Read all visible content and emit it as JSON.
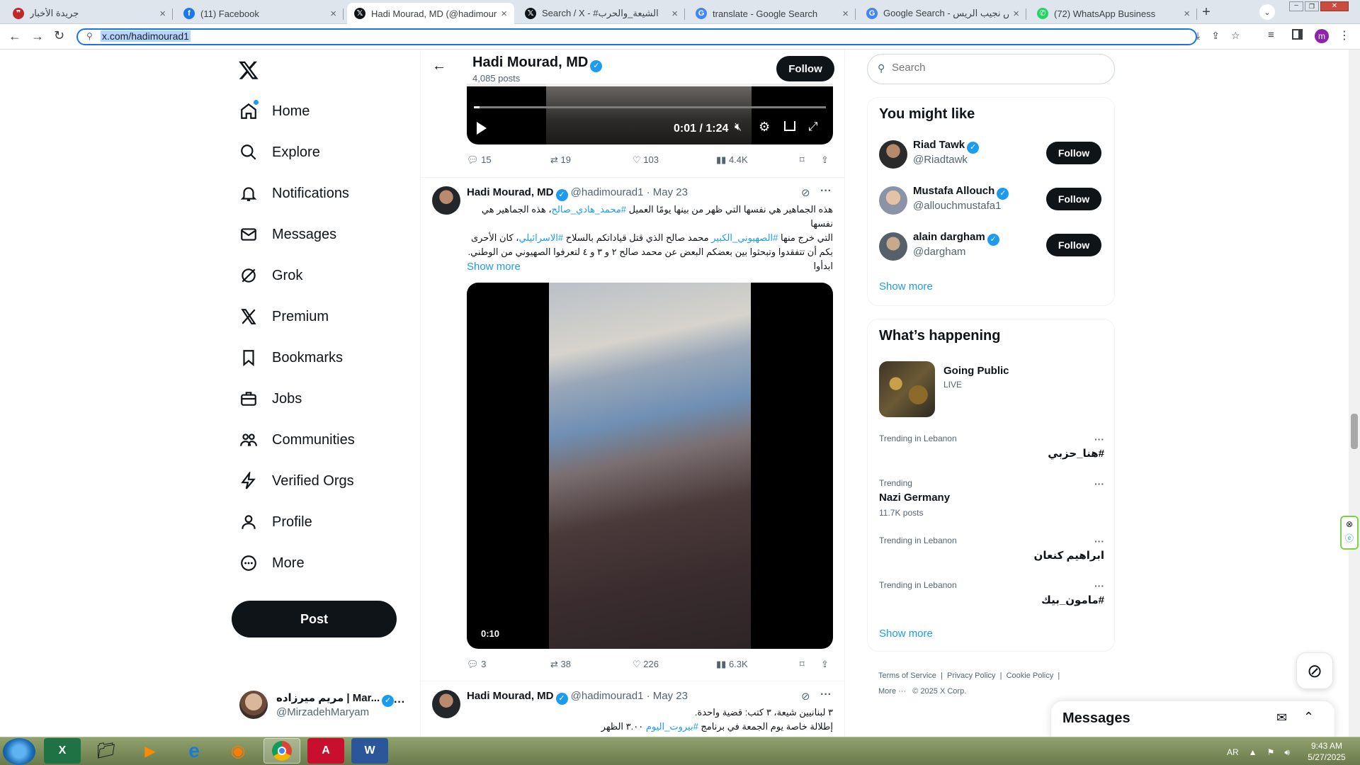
{
  "browser": {
    "tabs": [
      {
        "title": "جريدة الأخبار",
        "icon": "akhbar-favicon-icon",
        "active": false
      },
      {
        "title": "(11) Facebook",
        "icon": "facebook-favicon-icon",
        "active": false
      },
      {
        "title": "Hadi Mourad, MD (@hadimourad",
        "icon": "x-favicon-icon",
        "active": true
      },
      {
        "title": "Search / X - #الشيعة_والحرب",
        "icon": "x-favicon-icon",
        "active": false
      },
      {
        "title": "translate - Google Search",
        "icon": "google-favicon-icon",
        "active": false
      },
      {
        "title": "Google Search - رياض نجيب الريس",
        "icon": "google-favicon-icon",
        "active": false
      },
      {
        "title": "(72) WhatsApp Business",
        "icon": "whatsapp-favicon-icon",
        "active": false
      }
    ],
    "url": "x.com/hadimourad1",
    "profile_initial": "m"
  },
  "sidebar": {
    "nav": [
      {
        "label": "Home",
        "icon": "home-icon"
      },
      {
        "label": "Explore",
        "icon": "search-icon"
      },
      {
        "label": "Notifications",
        "icon": "bell-icon"
      },
      {
        "label": "Messages",
        "icon": "envelope-icon"
      },
      {
        "label": "Grok",
        "icon": "grok-icon"
      },
      {
        "label": "Premium",
        "icon": "x-logo-icon"
      },
      {
        "label": "Bookmarks",
        "icon": "bookmark-icon"
      },
      {
        "label": "Jobs",
        "icon": "briefcase-icon"
      },
      {
        "label": "Communities",
        "icon": "communities-icon"
      },
      {
        "label": "Verified Orgs",
        "icon": "lightning-icon"
      },
      {
        "label": "Profile",
        "icon": "person-icon"
      },
      {
        "label": "More",
        "icon": "more-circle-icon"
      }
    ],
    "post_label": "Post",
    "account": {
      "name": "مريم ميرزاده | Mar...",
      "handle": "@MirzadehMaryam"
    }
  },
  "header": {
    "name": "Hadi Mourad, MD",
    "posts": "4,085 posts",
    "follow_label": "Follow"
  },
  "top_video": {
    "time": "0:01 / 1:24",
    "replies": "15",
    "reposts": "19",
    "likes": "103",
    "views": "4.4K"
  },
  "tweets": [
    {
      "name": "Hadi Mourad, MD",
      "handle": "@hadimourad1",
      "date": "· May 23",
      "lines": [
        [
          {
            "t": "هذه الجماهير هي نفسها التي ظهر من بينها يومًا العميل "
          },
          {
            "t": "#محمد_هادي_صالح",
            "link": true
          },
          {
            "t": "، هذه الجماهير هي نفسها"
          }
        ],
        [
          {
            "t": "التي خرج منها "
          },
          {
            "t": "#الصهيوني_الكبير",
            "link": true
          },
          {
            "t": " محمد صالح الذي قتل قياداتكم بالسلاح "
          },
          {
            "t": "#الاسرائيلي",
            "link": true
          },
          {
            "t": "، كان الأحرى"
          }
        ],
        [
          {
            "t": "بكم أن تتفقدوا وتبحثوا بين بعضكم البعض عن محمد صالح ٢ و ٣ و ٤ لتعرفوا الصهيوني من الوطني."
          }
        ],
        [
          {
            "t": "ابدأوا"
          }
        ]
      ],
      "show_more": "Show more",
      "video_time": "0:10",
      "replies": "3",
      "reposts": "38",
      "likes": "226",
      "views": "6.3K"
    },
    {
      "name": "Hadi Mourad, MD",
      "handle": "@hadimourad1",
      "date": "· May 23",
      "lines": [
        [
          {
            "t": "٣ لبنانيين شيعة، ٣ كتب: قضية واحدة."
          }
        ],
        [
          {
            "t": "إطلالة خاصة يوم الجمعة في برنامج "
          },
          {
            "t": "#بيروت_اليوم",
            "link": true
          },
          {
            "t": " ٣.٠٠ الظهر"
          }
        ]
      ]
    }
  ],
  "right": {
    "search_placeholder": "Search",
    "you_might_like": {
      "title": "You might like",
      "users": [
        {
          "name": "Riad Tawk",
          "handle": "@Riadtawk",
          "button": "Follow"
        },
        {
          "name": "Mustafa Allouch",
          "handle": "@allouchmustafa1",
          "button": "Follow"
        },
        {
          "name": "alain dargham",
          "handle": "@dargham",
          "button": "Follow"
        }
      ],
      "show_more": "Show more"
    },
    "whats_happening": {
      "title": "What’s happening",
      "featured": {
        "title": "Going Public",
        "status": "LIVE"
      },
      "trends": [
        {
          "context": "Trending in Lebanon",
          "topic": "#هنا_حزبي",
          "count": ""
        },
        {
          "context": "Trending",
          "topic": "Nazi Germany",
          "count": "11.7K posts"
        },
        {
          "context": "Trending in Lebanon",
          "topic": "ابراهيم كنعان",
          "count": ""
        },
        {
          "context": "Trending in Lebanon",
          "topic": "#مامون_بيك",
          "count": ""
        }
      ],
      "show_more": "Show more"
    },
    "footer": {
      "links": [
        "Terms of Service",
        "Privacy Policy",
        "Cookie Policy"
      ],
      "more": "More ···",
      "copyright": "© 2025 X Corp."
    },
    "messages_label": "Messages"
  },
  "taskbar": {
    "lang": "AR",
    "time": "9:43 AM",
    "date": "5/27/2025"
  },
  "colors": {
    "accent": "#1d9bf0",
    "text": "#0f1419",
    "muted": "#536471",
    "omnibox_border": "#1a73e8"
  }
}
